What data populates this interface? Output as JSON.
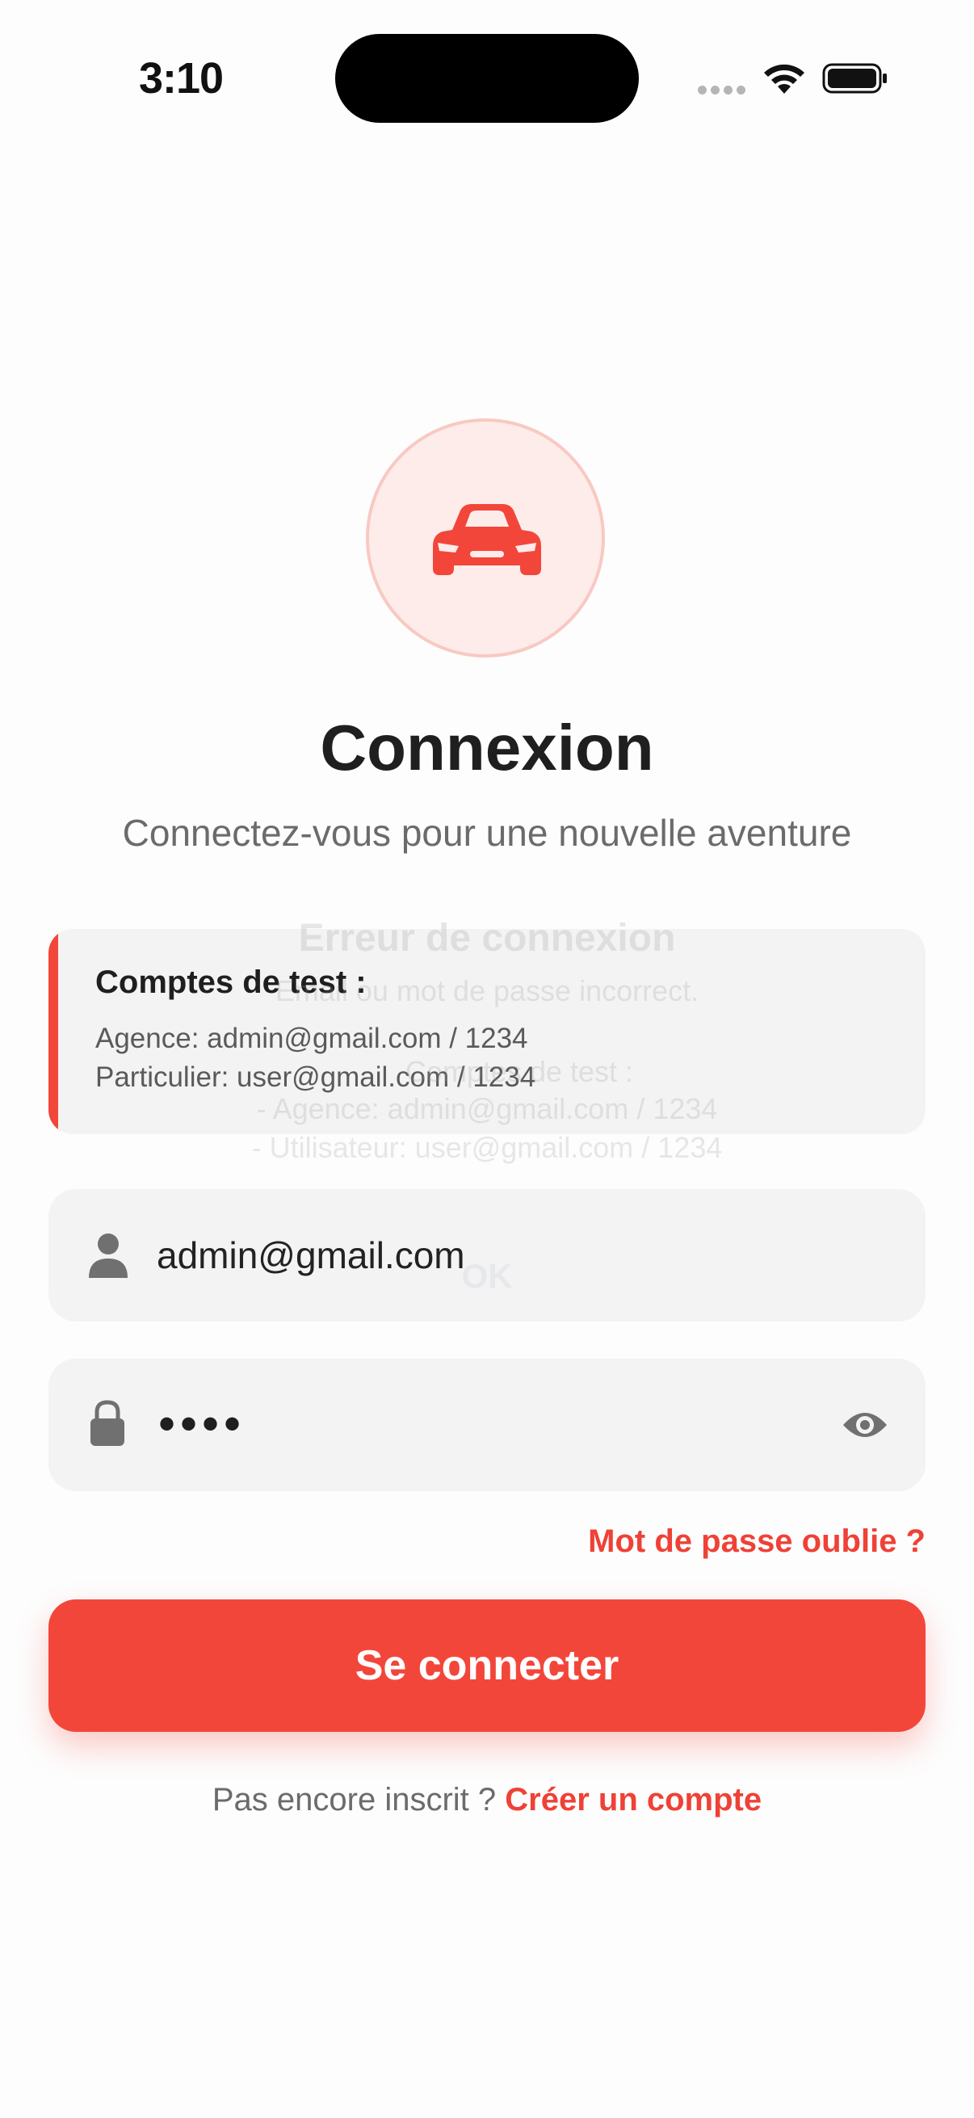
{
  "status_bar": {
    "time": "3:10",
    "icons": [
      "cellular-icon",
      "wifi-icon",
      "battery-icon"
    ]
  },
  "logo": {
    "icon": "car-icon",
    "accent_color": "#f3463a",
    "circle_color": "#fdecea"
  },
  "header": {
    "title": "Connexion",
    "subtitle": "Connectez-vous pour une nouvelle aventure"
  },
  "test_accounts": {
    "title": "Comptes de test :",
    "lines": [
      "Agence: admin@gmail.com / 1234",
      "Particulier: user@gmail.com / 1234"
    ]
  },
  "ghost_alert": {
    "title": "Erreur de connexion",
    "message": "Email ou mot de passe incorrect.",
    "hint": "Comptes de test :",
    "line1": "- Agence: admin@gmail.com / 1234",
    "line2": "- Utilisateur: user@gmail.com / 1234",
    "button": "OK"
  },
  "form": {
    "email": {
      "value": "admin@gmail.com",
      "icon": "user-icon"
    },
    "password": {
      "masked_value": "••••",
      "icon": "lock-icon",
      "toggle_icon": "eye-icon"
    },
    "forgot_label": "Mot de passe oublie ?",
    "submit_label": "Se connecter"
  },
  "signup": {
    "prompt": "Pas encore inscrit ?",
    "link": "Créer un compte"
  }
}
